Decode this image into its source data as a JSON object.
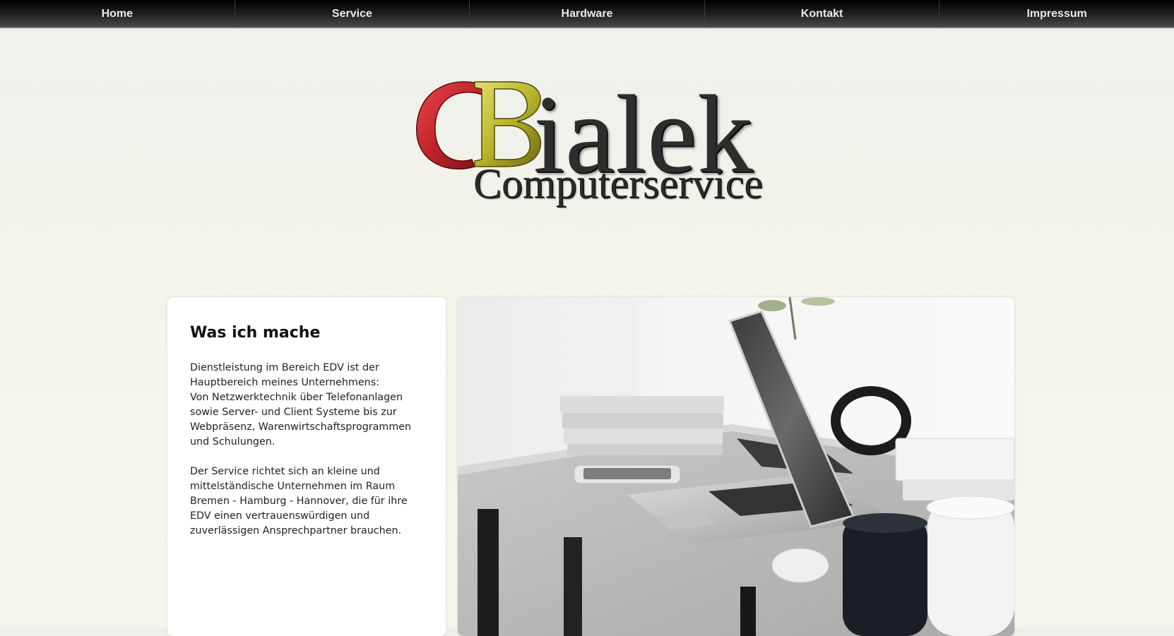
{
  "nav": {
    "items": [
      {
        "label": "Home"
      },
      {
        "label": "Service"
      },
      {
        "label": "Hardware"
      },
      {
        "label": "Kontakt"
      },
      {
        "label": "Impressum"
      }
    ]
  },
  "logo": {
    "text": "CBialek Computerservice",
    "colors": {
      "c_letter": "#c0242a",
      "b_letter": "#b9b52a",
      "text": "#2d2d2d"
    }
  },
  "main": {
    "card": {
      "title": "Was ich mache",
      "paragraph1": "Dienstleistung im Bereich EDV ist der\nHauptbereich meines Unternehmens:\nVon Netzwerktechnik über Telefonanlagen\nsowie Server- und Client Systeme bis zur\nWebpräsenz, Warenwirtschaftsprogrammen\nund Schulungen.",
      "paragraph2": "Der Service richtet sich an kleine und\nmittelständische Unternehmen im Raum\nBremen - Hamburg - Hannover, die für ihre\nEDV einen vertrauenswürdigen und\nzuverlässigen Ansprechpartner brauchen."
    },
    "photo": {
      "icon": "laptop-desk-photo"
    }
  },
  "colors": {
    "nav_bg": "#000000",
    "nav_text": "#e9e9e9",
    "page_bg": "#f3f3ea",
    "card_bg": "#ffffff"
  }
}
